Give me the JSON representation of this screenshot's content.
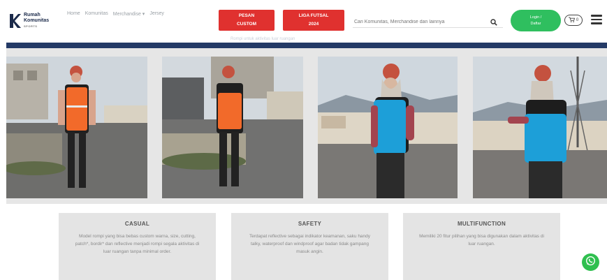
{
  "brand": {
    "line1": "Rumah",
    "line2": "Komunitas",
    "tagline": "SPORTS"
  },
  "nav": {
    "items": [
      "Home",
      "Komunitas",
      "Merchandise ▾",
      "Jersey"
    ]
  },
  "buttons": {
    "pesan_custom": [
      "PESAN",
      "CUSTOM"
    ],
    "liga_futsal": [
      "LIGA FUTSAL",
      "2024"
    ],
    "login": [
      "Login /",
      "Daftar"
    ]
  },
  "search": {
    "placeholder": "Cari Komunitas, Merchandise dan lainnya"
  },
  "cart": {
    "count": "0"
  },
  "band_text": "Rompi untuk aktivitas luar ruangan",
  "features": [
    {
      "title": "CASUAL",
      "text": "Model rompi yang bisa bebas custom warna, size, cutting, patch*, bordir* dan reflective menjadi rompi segala aktivitas di luar ruangan tanpa minimal order."
    },
    {
      "title": "SAFETY",
      "text": "Terdapat reflective sebagai indikator keamanan, saku handy talky, waterproof dan windproof agar badan tidak gampang masuk angin."
    },
    {
      "title": "MULTIFUNCTION",
      "text": "Memiliki 20 fitur pilihan yang bisa digunakan dalam aktivitas di luar ruangan."
    }
  ],
  "colors": {
    "accent_red": "#e0312f",
    "accent_green": "#2fbf5f",
    "navy": "#243a66",
    "vest_orange": "#f26a2a",
    "vest_blue": "#1d9fd8"
  },
  "icons": [
    "search-icon",
    "cart-icon",
    "menu-icon",
    "whatsapp-icon"
  ]
}
